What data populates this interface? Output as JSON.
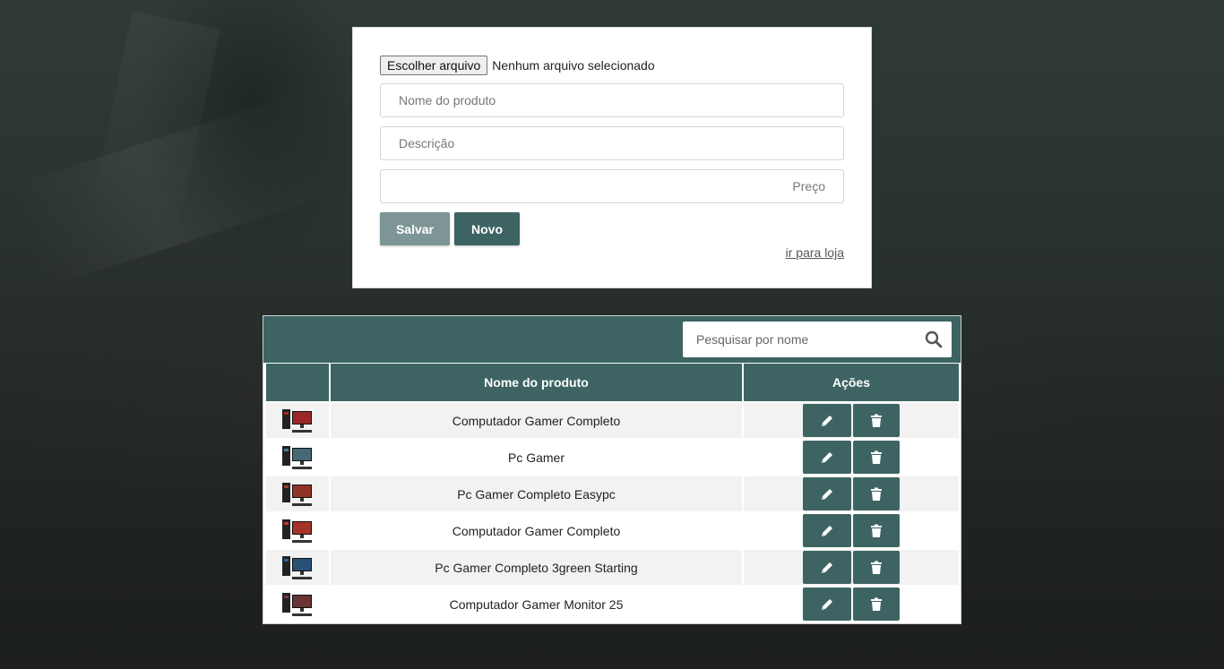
{
  "form": {
    "file_button_label": "Escolher arquivo",
    "file_status": "Nenhum arquivo selecionado",
    "nome_placeholder": "Nome do produto",
    "descricao_placeholder": "Descrição",
    "preco_placeholder": "Preço",
    "salvar_label": "Salvar",
    "novo_label": "Novo",
    "loja_link": "ir para loja"
  },
  "search": {
    "placeholder": "Pesquisar por nome",
    "icon": "search-icon"
  },
  "table": {
    "headers": [
      "",
      "Nome do produto",
      "Ações"
    ],
    "rows": [
      {
        "name": "Computador Gamer Completo",
        "thumb_color": "#b32a2a"
      },
      {
        "name": "Pc Gamer",
        "thumb_color": "#4d7a8a"
      },
      {
        "name": "Pc Gamer Completo Easypc",
        "thumb_color": "#a83a2c"
      },
      {
        "name": "Computador Gamer Completo",
        "thumb_color": "#c0392b"
      },
      {
        "name": "Pc Gamer Completo 3green Starting",
        "thumb_color": "#2e5d8a"
      },
      {
        "name": "Computador Gamer Monitor 25",
        "thumb_color": "#7a3b3b"
      }
    ],
    "actions": {
      "edit_icon": "pencil-icon",
      "delete_icon": "trash-icon"
    }
  },
  "colors": {
    "accent": "#3d6462",
    "salvar": "#7e9595"
  }
}
